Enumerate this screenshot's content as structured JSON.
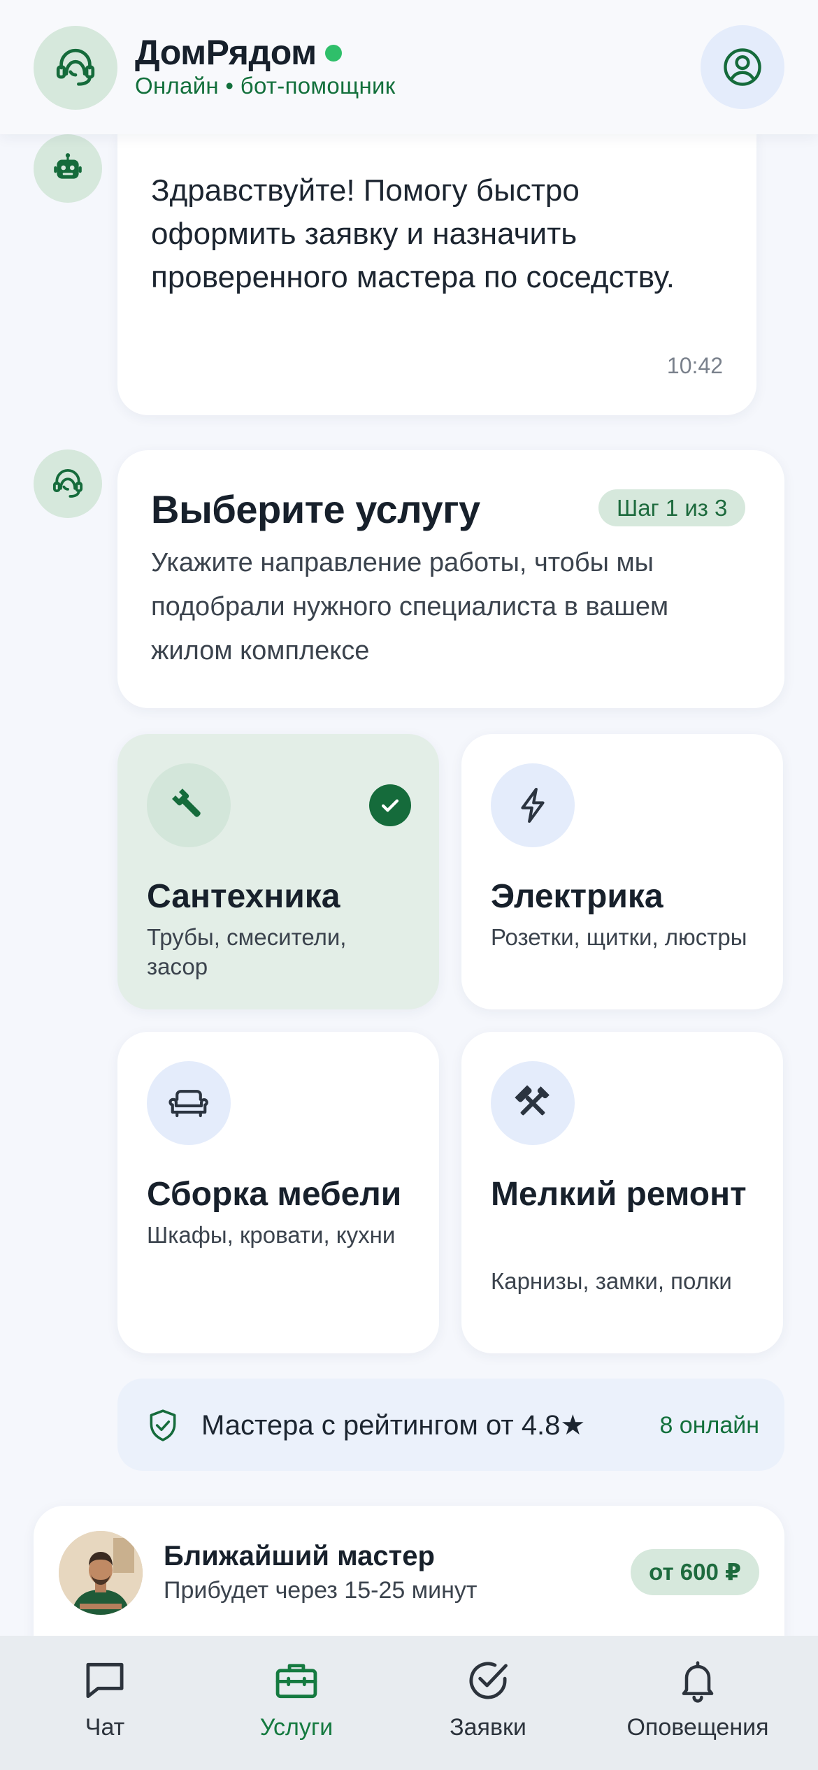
{
  "header": {
    "app_title": "ДомРядом",
    "subtitle": "Онлайн • бот-помощник"
  },
  "chat": {
    "greeting": {
      "text": "Здравствуйте! Помогу быстро оформить заявку и назначить проверенного мастера по соседству.",
      "time": "10:42"
    },
    "step_card": {
      "title": "Выберите услугу",
      "badge": "Шаг 1 из 3",
      "description": "Укажите направление работы, чтобы мы подобрали нужного специалиста в вашем жилом комплексе"
    }
  },
  "services": [
    {
      "name": "Сантехника",
      "description": "Трубы, смесители, засор",
      "icon": "wrench-icon",
      "selected": true
    },
    {
      "name": "Электрика",
      "description": "Розетки, щитки, люстры",
      "icon": "lightning-icon",
      "selected": false
    },
    {
      "name": "Сборка мебели",
      "description": "Шкафы, кровати, кухни",
      "icon": "sofa-icon",
      "selected": false
    },
    {
      "name": "Мелкий ремонт",
      "description": "Карнизы, замки, полки",
      "icon": "hammer-wrench-icon",
      "selected": false
    }
  ],
  "info_bar": {
    "text": "Мастера с рейтингом от 4.8★",
    "online": "8 онлайн"
  },
  "nearest_master": {
    "title": "Ближайший мастер",
    "eta": "Прибудет через 15-25 минут",
    "price": "от 600 ₽"
  },
  "tabs": [
    {
      "label": "Чат",
      "icon": "chat-bubble-icon",
      "active": false
    },
    {
      "label": "Услуги",
      "icon": "toolbox-icon",
      "active": true
    },
    {
      "label": "Заявки",
      "icon": "check-circle-icon",
      "active": false
    },
    {
      "label": "Оповещения",
      "icon": "bell-icon",
      "active": false
    }
  ],
  "colors": {
    "brand_green": "#156b3b",
    "online_dot": "#2fbf6a",
    "selected_card_bg": "#e3eee7",
    "info_bar_bg": "#ebf1fb"
  }
}
